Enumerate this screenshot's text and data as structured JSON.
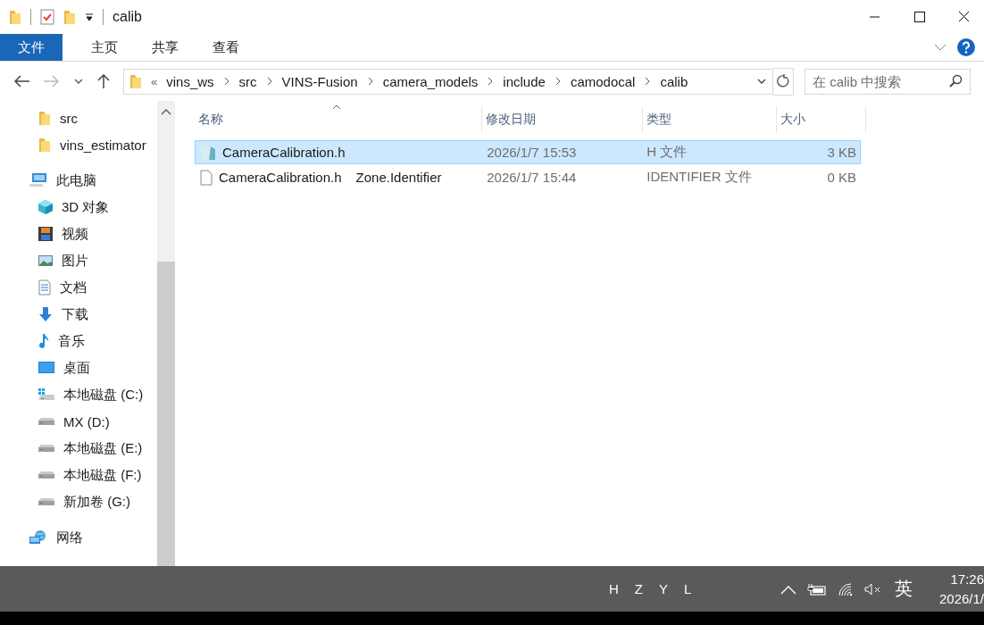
{
  "window": {
    "title": "calib"
  },
  "ribbon": {
    "tabs": [
      {
        "label": "文件",
        "kind": "file"
      },
      {
        "label": "主页",
        "kind": "tab"
      },
      {
        "label": "共享",
        "kind": "tab"
      },
      {
        "label": "查看",
        "kind": "tab"
      }
    ]
  },
  "address_bar": {
    "overflow": "«",
    "crumbs": [
      "vins_ws",
      "src",
      "VINS-Fusion",
      "camera_models",
      "include",
      "camodocal",
      "calib"
    ]
  },
  "search": {
    "placeholder": "在 calib 中搜索"
  },
  "sidebar": {
    "items": [
      {
        "children": [
          {
            "label": "src",
            "kind": "folder"
          },
          {
            "label": "vins_estimator",
            "kind": "folder"
          }
        ]
      },
      {
        "label": "此电脑",
        "kind": "pc",
        "children": [
          {
            "label": "3D 对象",
            "kind": "cube"
          },
          {
            "label": "视频",
            "kind": "video"
          },
          {
            "label": "图片",
            "kind": "picture"
          },
          {
            "label": "文档",
            "kind": "doc"
          },
          {
            "label": "下载",
            "kind": "download"
          },
          {
            "label": "音乐",
            "kind": "music"
          },
          {
            "label": "桌面",
            "kind": "desktop"
          },
          {
            "label": "本地磁盘 (C:)",
            "kind": "windrive"
          },
          {
            "label": "MX (D:)",
            "kind": "drive"
          },
          {
            "label": "本地磁盘 (E:)",
            "kind": "drive"
          },
          {
            "label": "本地磁盘 (F:)",
            "kind": "drive"
          },
          {
            "label": "新加卷 (G:)",
            "kind": "drive"
          }
        ]
      },
      {
        "label": "网络",
        "kind": "network"
      }
    ]
  },
  "table": {
    "columns": [
      "名称",
      "修改日期",
      "类型",
      "大小"
    ],
    "rows": [
      {
        "name": "CameraCalibration.h",
        "kind": "header",
        "date": "2026/1/7 15:53",
        "type": "H 文件",
        "size": "3 KB",
        "selected": true
      },
      {
        "name": "CameraCalibration.h",
        "stream": "Zone.Identifier",
        "kind": "blank",
        "date": "2026/1/7 15:44",
        "type": "IDENTIFIER 文件",
        "size": "0 KB",
        "selected": false
      }
    ]
  },
  "taskbar": {
    "input_letters": [
      "H",
      "Z",
      "Y",
      "L"
    ],
    "language": "英",
    "time": "17:26",
    "date": "2026/1/"
  }
}
